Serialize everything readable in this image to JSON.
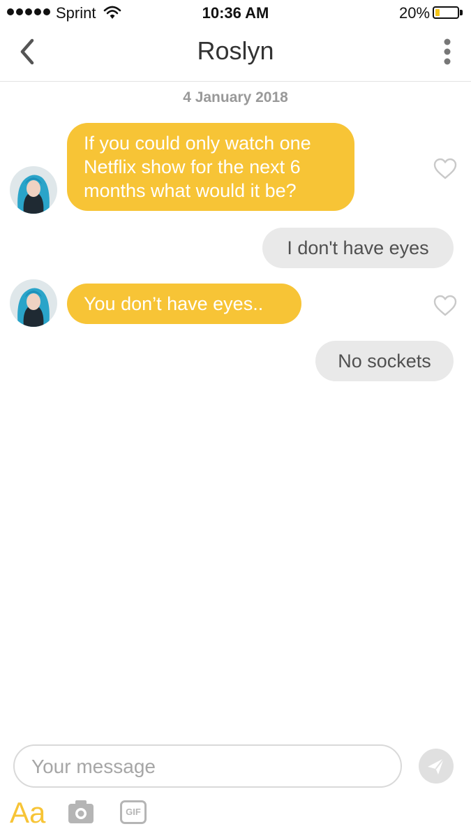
{
  "status_bar": {
    "carrier": "Sprint",
    "time": "10:36 AM",
    "battery_percent": "20%",
    "battery_level": 0.2
  },
  "header": {
    "title": "Roslyn",
    "back_icon": "chevron-left-icon",
    "menu_icon": "more-vertical-icon"
  },
  "conversation": {
    "date": "4 January 2018",
    "messages": [
      {
        "from": "them",
        "text": "If you could only watch one Netflix show for the next 6 months what would it be?"
      },
      {
        "from": "me",
        "text": "I don't have eyes"
      },
      {
        "from": "them",
        "text": "You don’t have eyes.."
      },
      {
        "from": "me",
        "text": "No sockets"
      }
    ]
  },
  "composer": {
    "placeholder": "Your message",
    "font_label": "Aa",
    "gif_label": "GIF",
    "send_icon": "send-icon",
    "camera_icon": "camera-icon"
  },
  "colors": {
    "incoming_bubble": "#f7c436",
    "outgoing_bubble": "#e9e9e9",
    "accent": "#f7c436"
  }
}
